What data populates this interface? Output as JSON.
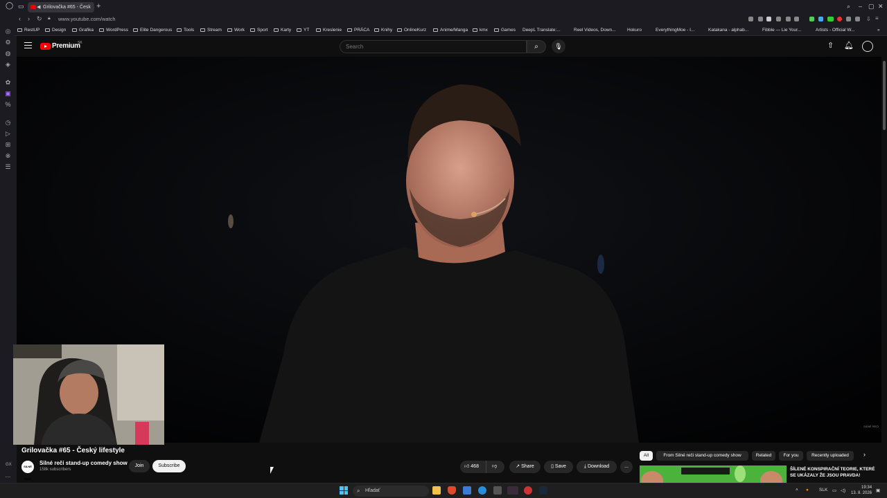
{
  "browser": {
    "tab_title": "Grilovačka #65 - Česk",
    "new_tab": "+",
    "url": "www.youtube.com/watch",
    "bookmarks": [
      "RestUP",
      "Design",
      "Grafika",
      "WordPress",
      "Elite Dangerous",
      "Tools",
      "Stream",
      "Work",
      "Sport",
      "Karty",
      "YT",
      "Kreslenie",
      "PRÁCA",
      "Knihy",
      "OnlineKurz",
      "Anime/Manga",
      "kmx",
      "Games",
      "DeepL Translate:...",
      "Reel Videos, Down...",
      "Hokuro",
      "EverythingMoe - I...",
      "Katakana - alphab...",
      "Fibble — Lie Your...",
      "Artists - Official W..."
    ]
  },
  "youtube": {
    "brand": "Premium",
    "country": "SK",
    "search_placeholder": "Search",
    "video_title": "Grilovačka #65 - Český lifestyle",
    "channel_name": "Silné reči stand-up comedy show",
    "channel_avatar_text": "SILNÉ REČI",
    "subscribers": "158k subscribers",
    "join_label": "Join",
    "subscribe_label": "Subscribe",
    "likes": "468",
    "share_label": "Share",
    "save_label": "Save",
    "download_label": "Download",
    "more_label": "...",
    "gx_label": "GX",
    "chips": [
      "All",
      "From Silné reči stand-up comedy show",
      "Related",
      "For you",
      "Recently uploaded"
    ],
    "next_video_title": "ŠÍLENÉ KONSPIRAČNÍ TEORIE, KTERÉ SE UKÁZALY ŽE JSOU PRAVDA!",
    "watermark": "SILNÉ REČI"
  },
  "taskbar": {
    "search_placeholder": "Hľadať",
    "language": "SLK",
    "time": "19:34",
    "date": "13. 8. 2026"
  },
  "colors": {
    "youtube_red": "#ff0000",
    "background": "#0f0f0f",
    "chip_bg": "#272727",
    "windows_accent": "#4cc2ff"
  }
}
